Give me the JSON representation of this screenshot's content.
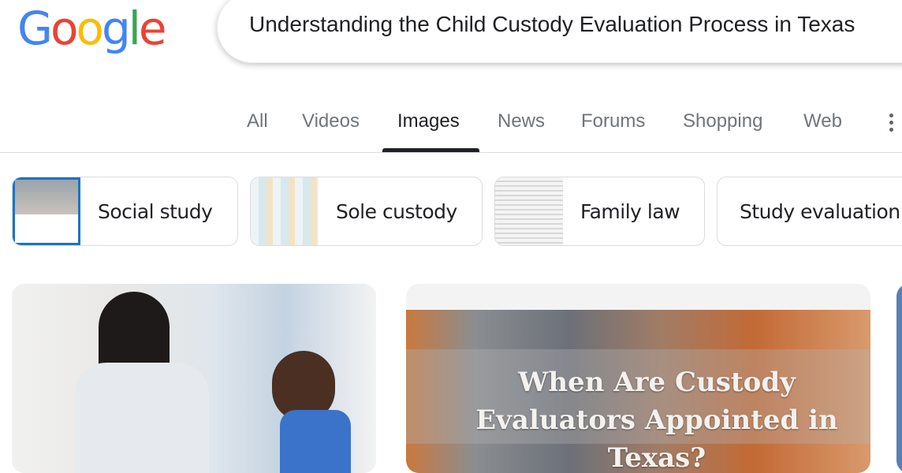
{
  "logo": {
    "letters": [
      "G",
      "o",
      "o",
      "g",
      "l",
      "e"
    ],
    "colors": [
      "#4285f4",
      "#ea4335",
      "#fbbc05",
      "#4285f4",
      "#34a853",
      "#ea4335"
    ]
  },
  "search": {
    "query": "Understanding the Child Custody Evaluation Process in Texas"
  },
  "tabs": [
    {
      "label": "All"
    },
    {
      "label": "Videos"
    },
    {
      "label": "Images",
      "active": true
    },
    {
      "label": "News"
    },
    {
      "label": "Forums"
    },
    {
      "label": "Shopping"
    },
    {
      "label": "Web"
    }
  ],
  "more_icon": "more-vert-icon",
  "chips": [
    {
      "label": "Social study"
    },
    {
      "label": "Sole custody"
    },
    {
      "label": "Family law"
    },
    {
      "label": "Study evaluation"
    }
  ],
  "results": [
    {
      "caption": ""
    },
    {
      "caption": "When Are Custody Evaluators Appointed in Texas?"
    }
  ]
}
